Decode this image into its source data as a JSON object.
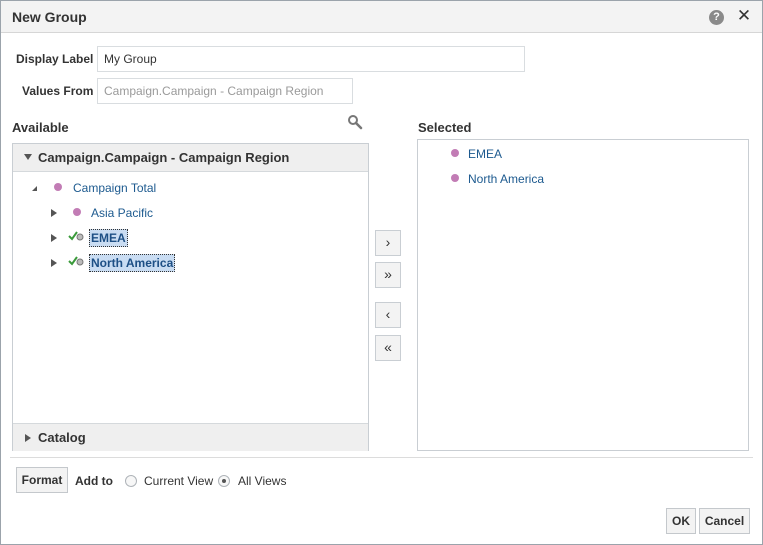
{
  "dialog": {
    "title": "New Group",
    "help_glyph": "?",
    "close_glyph": "✕"
  },
  "form": {
    "display_label_label": "Display Label",
    "display_label_value": "My Group",
    "values_from_label": "Values From",
    "values_from_value": "Campaign.Campaign - Campaign Region"
  },
  "available": {
    "title": "Available",
    "panel_title": "Campaign.Campaign - Campaign Region",
    "tree": {
      "root": "Campaign Total",
      "children": [
        "Asia Pacific",
        "EMEA",
        "North America"
      ]
    },
    "catalog_label": "Catalog"
  },
  "selected": {
    "title": "Selected",
    "items": [
      "EMEA",
      "North America"
    ]
  },
  "shuttle": {
    "move_label": "›",
    "move_all_label": "»",
    "remove_label": "‹",
    "remove_all_label": "«"
  },
  "footer": {
    "format_label": "Format",
    "add_to_label": "Add to",
    "current_view_label": "Current View",
    "all_views_label": "All Views",
    "selected_scope": "All Views",
    "ok_label": "OK",
    "cancel_label": "Cancel"
  },
  "colors": {
    "member_dot": "#c27cb5",
    "link_text": "#1d5a8f",
    "selection_bg": "#c9dcf2"
  },
  "icons": [
    "help-icon",
    "close-icon",
    "search-icon",
    "member-dot-icon",
    "selected-check-icon",
    "expand-arrow-icon",
    "collapse-arrow-icon"
  ]
}
